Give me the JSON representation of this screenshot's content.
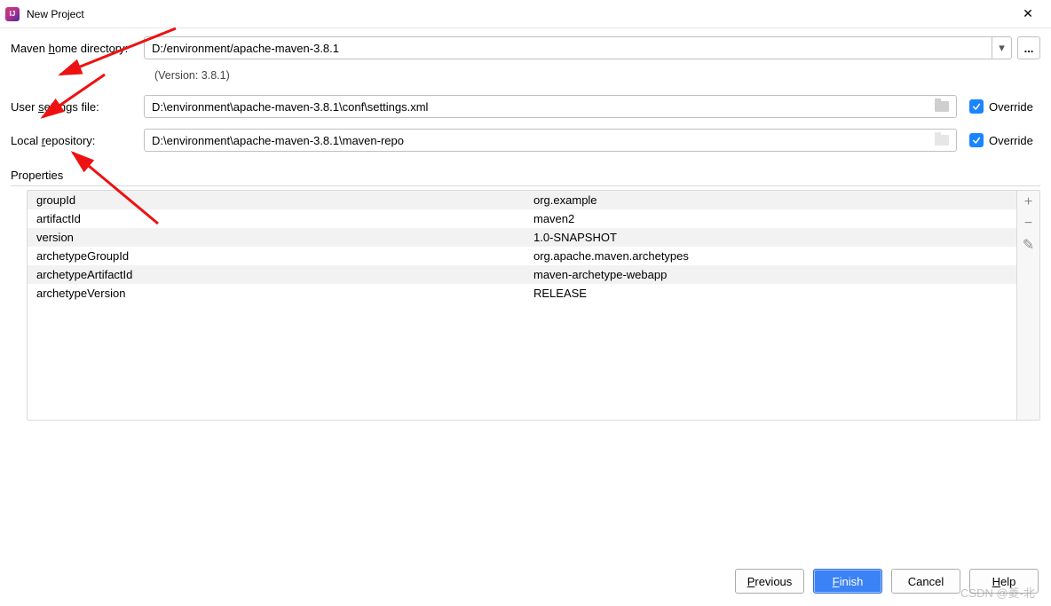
{
  "window": {
    "title": "New Project"
  },
  "form": {
    "mavenHome": {
      "label_pre": "Maven ",
      "label_ul": "h",
      "label_post": "ome directory:",
      "value": "D:/environment/apache-maven-3.8.1",
      "version_note": "(Version: 3.8.1)"
    },
    "userSettings": {
      "label_pre": "User ",
      "label_ul": "s",
      "label_post": "ettings file:",
      "value": "D:\\environment\\apache-maven-3.8.1\\conf\\settings.xml",
      "override_label": "Override",
      "override_checked": true
    },
    "localRepo": {
      "label_pre": "Local ",
      "label_ul": "r",
      "label_post": "epository:",
      "value": "D:\\environment\\apache-maven-3.8.1\\maven-repo",
      "override_label": "Override",
      "override_checked": true
    }
  },
  "properties": {
    "section_label": "Properties",
    "rows": [
      {
        "key": "groupId",
        "value": "org.example"
      },
      {
        "key": "artifactId",
        "value": "maven2"
      },
      {
        "key": "version",
        "value": "1.0-SNAPSHOT"
      },
      {
        "key": "archetypeGroupId",
        "value": "org.apache.maven.archetypes"
      },
      {
        "key": "archetypeArtifactId",
        "value": "maven-archetype-webapp"
      },
      {
        "key": "archetypeVersion",
        "value": "RELEASE"
      }
    ],
    "toolbar": {
      "add": "+",
      "remove": "−",
      "edit": "✎"
    }
  },
  "buttons": {
    "previous_ul": "P",
    "previous_post": "revious",
    "finish_ul": "F",
    "finish_post": "inish",
    "cancel": "Cancel",
    "help_ul": "H",
    "help_post": "elp"
  },
  "browse": {
    "label": "..."
  },
  "watermark": "CSDN @菱-北"
}
